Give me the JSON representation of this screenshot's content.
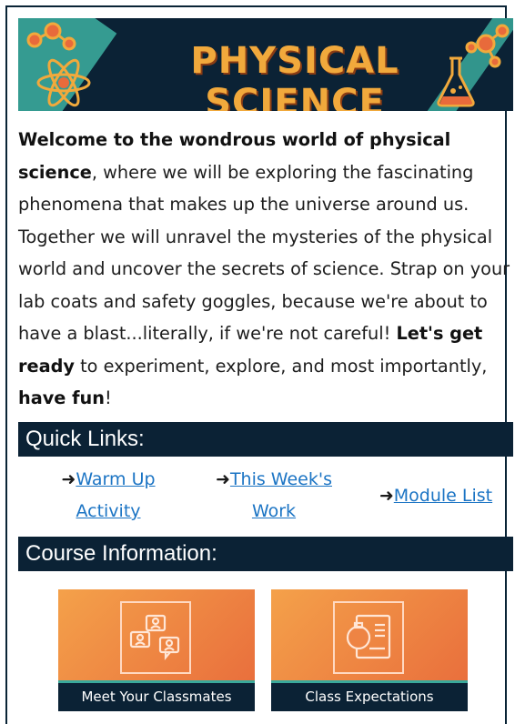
{
  "banner": {
    "title": "PHYSICAL SCIENCE"
  },
  "intro": {
    "bold_lead": "Welcome to the wondrous world of physical science",
    "text_1": ", where we will be exploring the fascinating phenomena that makes up the universe around us. Together we will unravel the mysteries of the physical world and uncover the secrets of science. Strap on your lab coats and safety goggles, because we're about to have a blast...literally, if we're not careful! ",
    "bold_2": "Let's get ready",
    "text_2": " to experiment, explore, and most importantly, ",
    "bold_3": "have fun",
    "text_3": "!"
  },
  "quick_links": {
    "heading": "Quick Links:",
    "arrow": "➜",
    "items": [
      {
        "label_line1": "Warm Up",
        "label_line2": "Activity"
      },
      {
        "label_line1": "This Week's",
        "label_line2": "Work"
      },
      {
        "label_line1": "Module List",
        "label_line2": ""
      }
    ]
  },
  "course_info": {
    "heading": "Course Information:",
    "cards": [
      {
        "label": "Meet Your Classmates",
        "icon": "chat-people-icon"
      },
      {
        "label": "Class Expectations",
        "icon": "lab-notebook-icon"
      }
    ]
  },
  "colors": {
    "navy": "#0b2235",
    "teal": "#3aa99b",
    "orange": "#f1a93c",
    "link": "#1b74c4"
  }
}
